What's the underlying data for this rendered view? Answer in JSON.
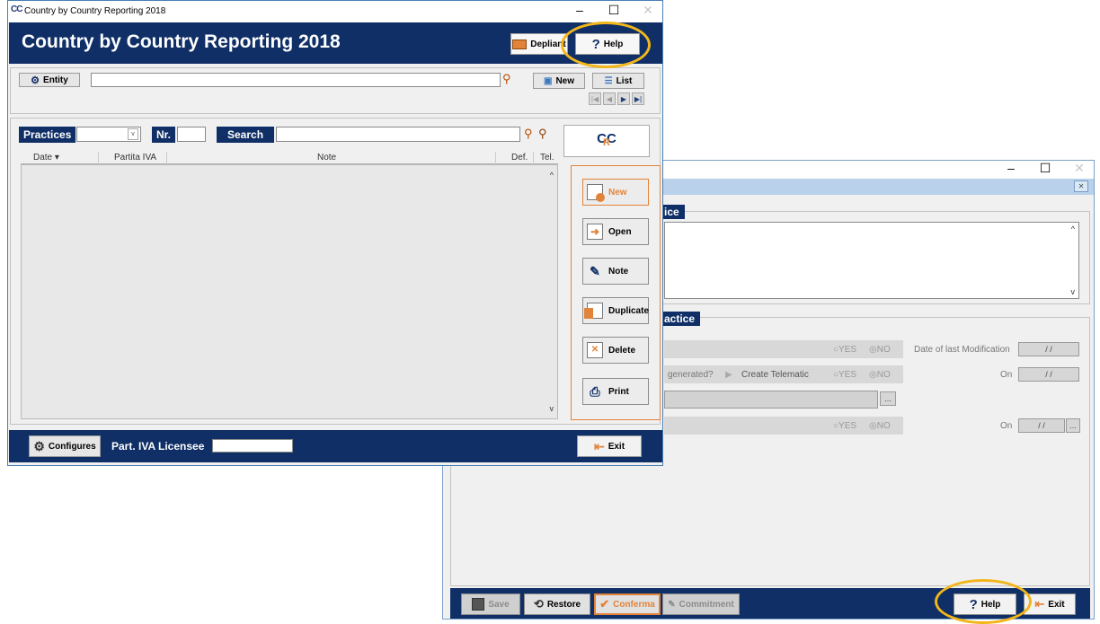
{
  "main_window": {
    "title": "Country by Country Reporting 2018",
    "app_icon": "CC",
    "header_title": "Country by Country Reporting 2018",
    "depliant_label": "Depliant",
    "help_label": "Help",
    "entity_label": "Entity",
    "entity_value": "",
    "new_label": "New",
    "list_label": "List",
    "practices_label": "Practices",
    "nr_label": "Nr.",
    "search_label": "Search",
    "columns": [
      "Date",
      "Partita IVA",
      "Note",
      "Def.",
      "Tel."
    ],
    "logo_text": "CC",
    "logo_r": "R",
    "side_buttons": [
      "New",
      "Open",
      "Note",
      "Duplicate",
      "Delete",
      "Print"
    ],
    "configures_label": "Configures",
    "licensee_label": "Part. IVA Licensee",
    "exit_label": "Exit"
  },
  "second_window": {
    "group1_title": "ice",
    "group2_title": "actice",
    "yes_label": "YES",
    "no_label": "NO",
    "date_mod_label": "Date of last Modification",
    "date_value": "/ /",
    "generated_label": "generated?",
    "create_telematic_label": "Create Telematic",
    "on_label": "On",
    "ellipsis": "...",
    "bottom_buttons": {
      "save": "Save",
      "restore": "Restore",
      "conferma": "Conferma",
      "commitment": "Commitment",
      "help": "Help",
      "exit": "Exit"
    }
  },
  "colors": {
    "navy": "#0f2f66",
    "accent_orange": "#e2833a",
    "highlight_ring": "#f2b61a"
  }
}
